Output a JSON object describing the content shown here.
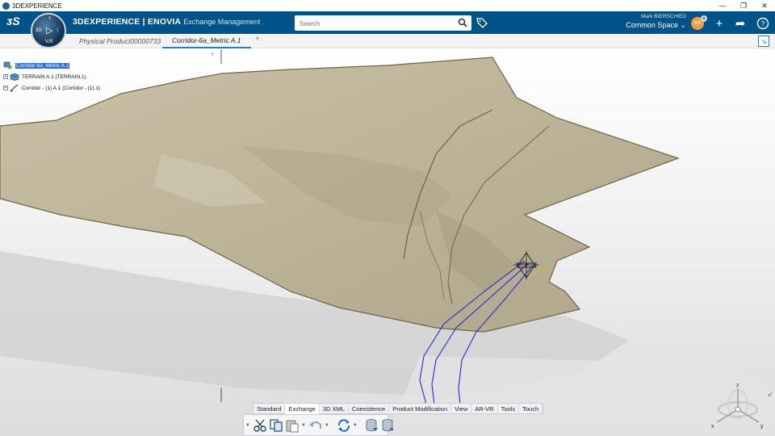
{
  "window": {
    "title": "3DEXPERIENCE"
  },
  "header": {
    "brand_bold": "3DEXPERIENCE | ENOVIA",
    "brand_sub": "Exchange Management",
    "compass": {
      "top": "?",
      "left": "3D",
      "center": "▷",
      "right": "i",
      "bottom": "V,R"
    },
    "search_placeholder": "Search",
    "user_name": "Mark BIERSCHIED",
    "user_initials": "MB",
    "space_label": "Common Space ⌄",
    "accent": "#005386"
  },
  "tabs": [
    {
      "label": "Physical Product00000733",
      "active": false
    },
    {
      "label": "Corridor-6a_Metric A.1",
      "active": true
    }
  ],
  "tab_add": "+",
  "tree": {
    "root": "Corridor-6a_Metric A.1",
    "children": [
      {
        "label": "TERRAIN A.1 (TERRAIN.1)",
        "icon": "terrain-icon"
      },
      {
        "label": "Corridor - (1) A.1 (Corridor - (1).1)",
        "icon": "corridor-icon"
      }
    ]
  },
  "action_bar": {
    "tabs": [
      "Standard",
      "Exchange",
      "3D XML",
      "Coexistence",
      "Product Modification",
      "View",
      "AR-VR",
      "Tools",
      "Touch"
    ],
    "active_tab": "Exchange",
    "tools": [
      "cut-icon",
      "copy-icon",
      "paste-icon",
      "undo-icon",
      "update-icon",
      "database-import-icon",
      "database-export-icon"
    ]
  },
  "axes": {
    "x": "x",
    "y": "y",
    "z": "z"
  }
}
